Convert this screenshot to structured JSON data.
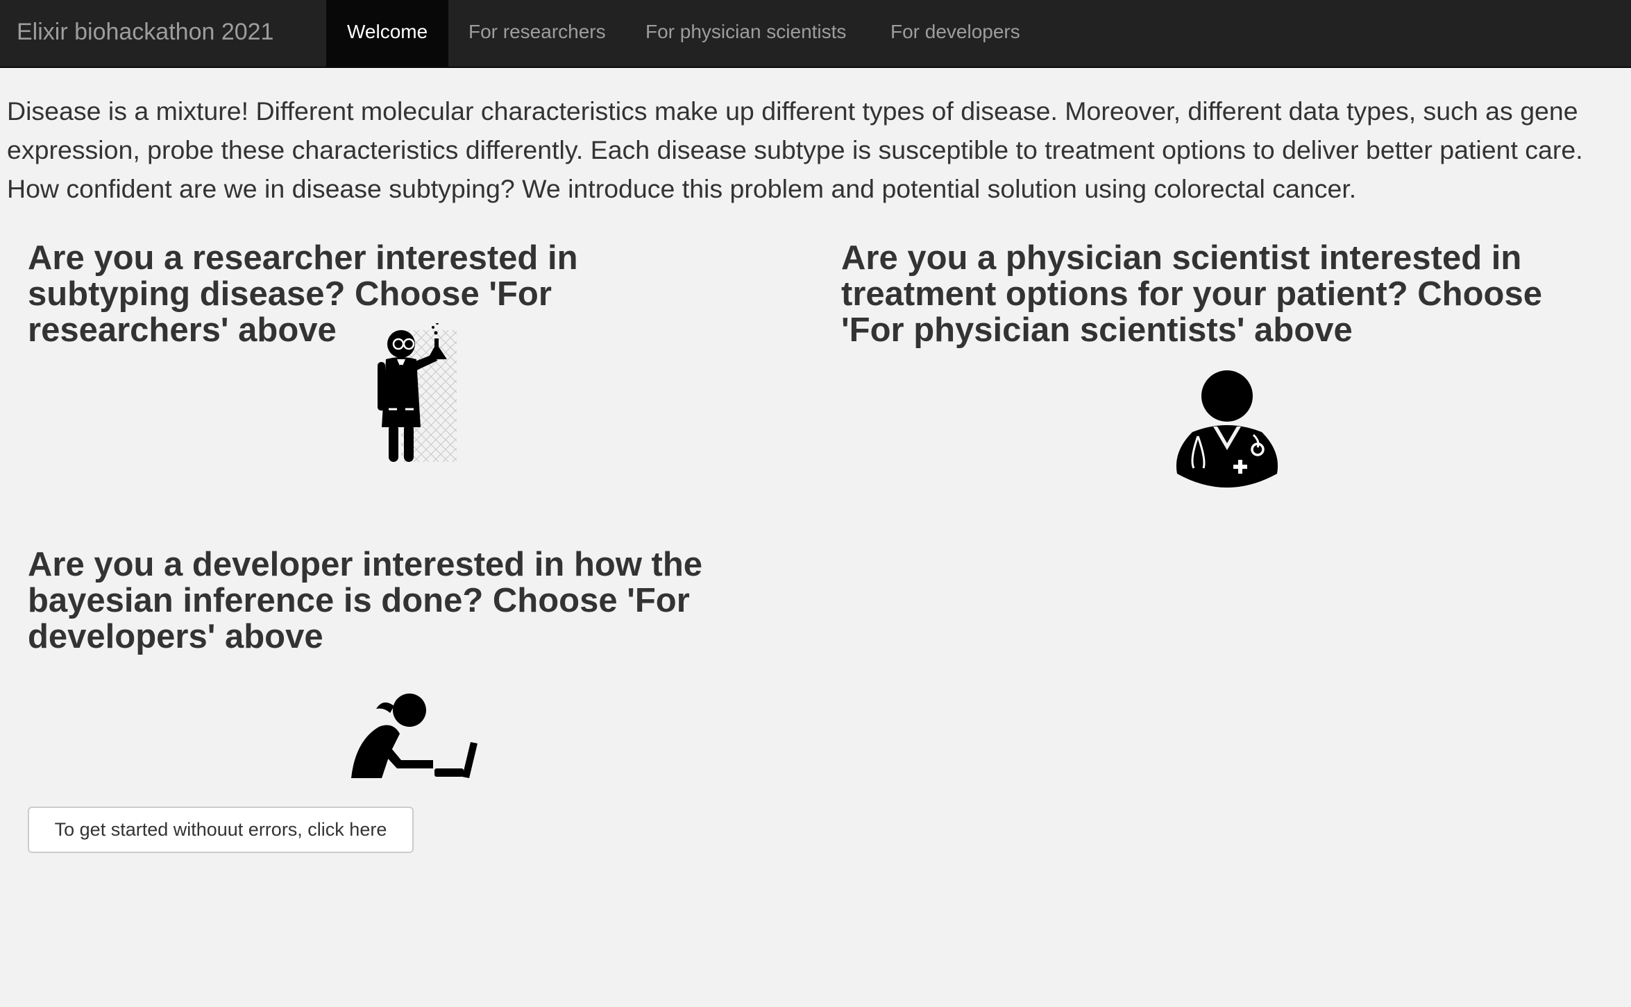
{
  "app": {
    "brand": "Elixir biohackathon 2021"
  },
  "nav": {
    "tabs": [
      {
        "label": "Welcome",
        "active": true
      },
      {
        "label": "For researchers",
        "active": false
      },
      {
        "label": "For physician scientists",
        "active": false
      },
      {
        "label": "For developers",
        "active": false
      }
    ]
  },
  "main": {
    "intro": "Disease is a mixture! Different molecular characteristics make up different types of disease. Moreover, different data types, such as gene expression, probe these characteristics differently. Each disease subtype is susceptible to treatment options to deliver better patient care. How confident are we in disease subtyping? We introduce this problem and potential solution using colorectal cancer.",
    "researcher_heading": "Are you a researcher interested in subtyping disease? Choose 'For researchers' above",
    "physician_heading": "Are you a physician scientist interested in treatment options for your patient? Choose 'For physician scientists' above",
    "developer_heading": "Are you a developer interested in how the bayesian inference is done? Choose 'For developers' above",
    "start_button_label": "To get started withouut errors, click here"
  },
  "icons": {
    "researcher": "scientist-icon",
    "physician": "doctor-icon",
    "developer": "developer-at-laptop-icon"
  },
  "colors": {
    "navbar_bg": "#222222",
    "nav_active_bg": "#080808",
    "nav_text": "#9d9d9d",
    "nav_active_text": "#ffffff",
    "page_bg": "#f2f2f2",
    "text": "#333333"
  }
}
